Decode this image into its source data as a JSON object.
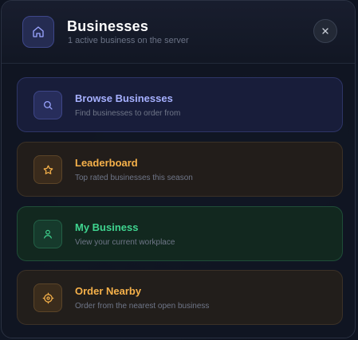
{
  "header": {
    "title": "Businesses",
    "subtitle": "1 active business on the server",
    "icon": "home-icon",
    "close_icon": "close-icon"
  },
  "menu": [
    {
      "id": "browse",
      "icon": "search-icon",
      "title": "Browse Businesses",
      "description": "Find businesses to order from",
      "accent": "#a6b0ff"
    },
    {
      "id": "leaderboard",
      "icon": "star-icon",
      "title": "Leaderboard",
      "description": "Top rated businesses this season",
      "accent": "#f6b14a"
    },
    {
      "id": "my-business",
      "icon": "user-icon",
      "title": "My Business",
      "description": "View your current workplace",
      "accent": "#3fd48f"
    },
    {
      "id": "order-nearby",
      "icon": "target-icon",
      "title": "Order Nearby",
      "description": "Order from the nearest open business",
      "accent": "#f6b14a"
    }
  ]
}
